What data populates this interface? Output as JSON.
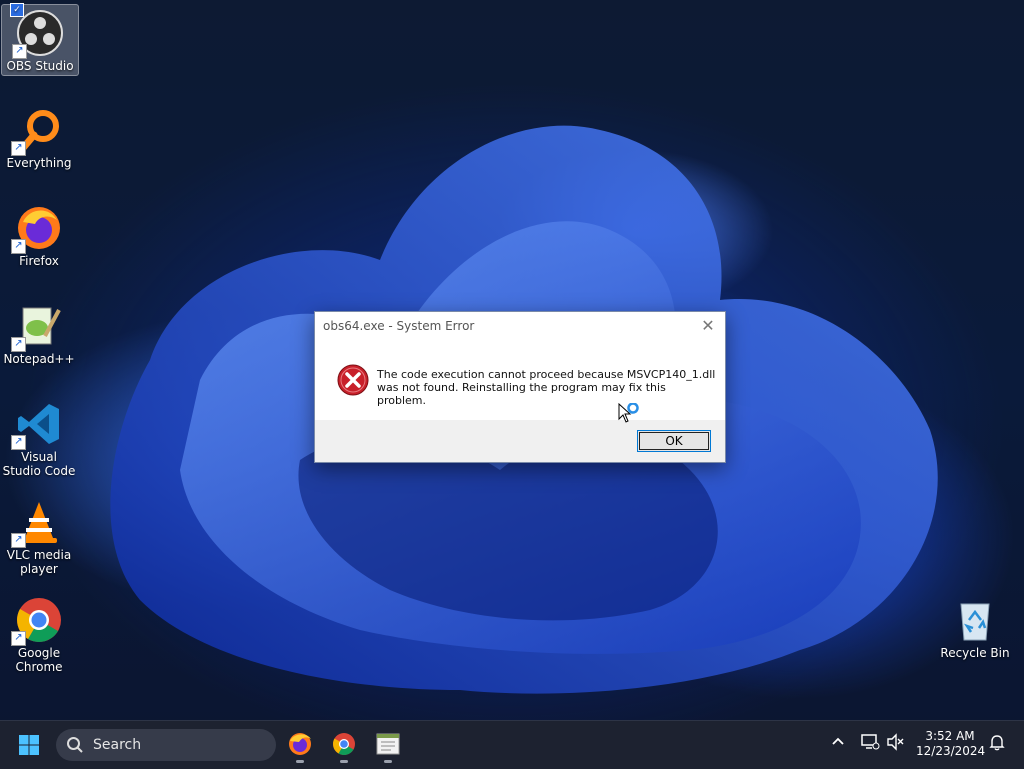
{
  "desktop": {
    "icons": [
      {
        "label": "OBS Studio"
      },
      {
        "label": "Everything"
      },
      {
        "label": "Firefox"
      },
      {
        "label": "Notepad++"
      },
      {
        "label": "Visual Studio Code"
      },
      {
        "label": "VLC media player"
      },
      {
        "label": "Google Chrome"
      },
      {
        "label": "Recycle Bin"
      }
    ]
  },
  "dialog": {
    "title": "obs64.exe - System Error",
    "message": "The code execution cannot proceed because MSVCP140_1.dll was not found. Reinstalling the program may fix this problem.",
    "ok_label": "OK"
  },
  "taskbar": {
    "search_label": "Search",
    "pinned": [
      "firefox-icon",
      "chrome-icon",
      "notepad-icon"
    ],
    "clock_time": "3:52 AM",
    "clock_date": "12/23/2024"
  },
  "colors": {
    "taskbar_bg": "#1d2230",
    "error_red": "#c8202a",
    "button_border": "#0078d4"
  }
}
